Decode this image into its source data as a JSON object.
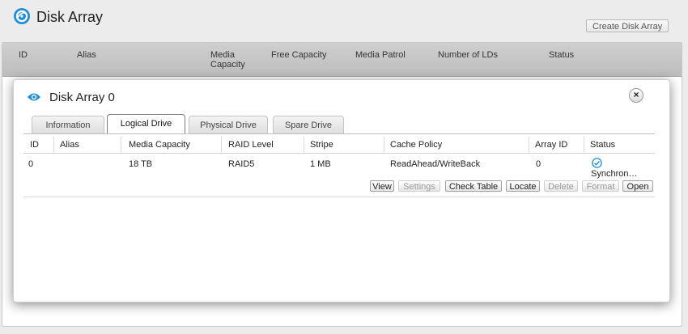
{
  "page": {
    "title": "Disk Array",
    "create_button": "Create Disk Array"
  },
  "main_table": {
    "columns": [
      "ID",
      "Alias",
      "Media Capacity",
      "Free Capacity",
      "Media Patrol",
      "Number of LDs",
      "Status"
    ]
  },
  "dialog": {
    "title": "Disk Array 0",
    "close_symbol": "×",
    "tabs": [
      {
        "label": "Information",
        "active": false
      },
      {
        "label": "Logical Drive",
        "active": true
      },
      {
        "label": "Physical Drive",
        "active": false
      },
      {
        "label": "Spare Drive",
        "active": false
      }
    ],
    "ld_table": {
      "columns": [
        "ID",
        "Alias",
        "Media Capacity",
        "RAID Level",
        "Stripe",
        "Cache Policy",
        "Array ID",
        "Status"
      ],
      "rows": [
        {
          "id": "0",
          "alias": "",
          "capacity": "18 TB",
          "raid": "RAID5",
          "stripe": "1 MB",
          "cache": "ReadAhead/WriteBack",
          "array_id": "0",
          "status": "Synchron…",
          "status_icon": "check-circle-icon"
        }
      ]
    },
    "actions": [
      {
        "label": "View",
        "enabled": true
      },
      {
        "label": "Settings",
        "enabled": false
      },
      {
        "label": "Check Table",
        "enabled": true
      },
      {
        "label": "Locate",
        "enabled": true
      },
      {
        "label": "Delete",
        "enabled": false
      },
      {
        "label": "Format",
        "enabled": false
      },
      {
        "label": "Open",
        "enabled": true
      }
    ]
  },
  "colors": {
    "accent": "#1e8fd6",
    "header_bg": "#c6c6c6",
    "page_bg": "#ececec"
  },
  "icons": {
    "app": "disk-array-logo-icon",
    "dialog": "eye-icon",
    "close": "close-icon"
  }
}
